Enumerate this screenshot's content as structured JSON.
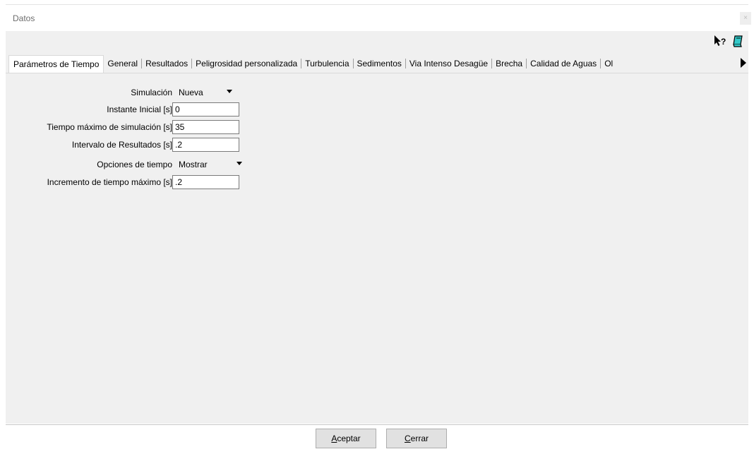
{
  "window": {
    "title": "Datos",
    "close_label": "×"
  },
  "tabs": [
    {
      "label": "Parámetros de Tiempo",
      "active": true
    },
    {
      "label": "General"
    },
    {
      "label": "Resultados"
    },
    {
      "label": "Peligrosidad personalizada"
    },
    {
      "label": "Turbulencia"
    },
    {
      "label": "Sedimentos"
    },
    {
      "label": "Via Intenso Desagüe"
    },
    {
      "label": "Brecha"
    },
    {
      "label": "Calidad de Aguas"
    },
    {
      "label": "Ol"
    }
  ],
  "form": {
    "simulacion": {
      "label": "Simulación",
      "value": "Nueva"
    },
    "instante_inicial": {
      "label": "Instante Inicial [s]",
      "value": "0"
    },
    "tiempo_maximo": {
      "label": "Tiempo máximo de simulación [s]",
      "value": "35"
    },
    "intervalo_resultados": {
      "label": "Intervalo de Resultados [s]",
      "value": ".2"
    },
    "opciones_tiempo": {
      "label": "Opciones de tiempo",
      "value": "Mostrar"
    },
    "incremento_maximo": {
      "label": "Incremento de tiempo máximo [s]",
      "value": ".2"
    }
  },
  "buttons": {
    "aceptar": {
      "accel": "A",
      "rest": "ceptar"
    },
    "cerrar": {
      "accel": "C",
      "rest": "errar"
    }
  },
  "icons": {
    "help": "context-help-icon",
    "eraser": "eraser-icon"
  }
}
